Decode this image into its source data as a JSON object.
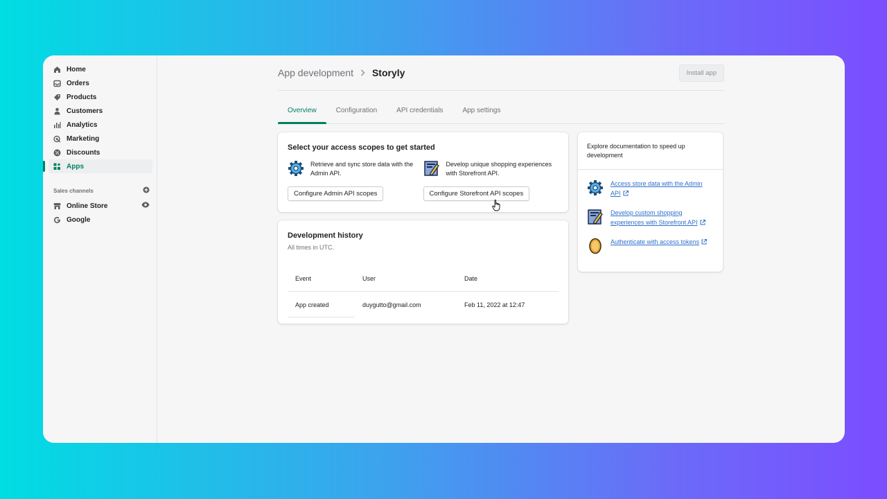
{
  "sidebar": {
    "items": [
      {
        "label": "Home",
        "icon": "home-icon"
      },
      {
        "label": "Orders",
        "icon": "orders-icon"
      },
      {
        "label": "Products",
        "icon": "tag-icon"
      },
      {
        "label": "Customers",
        "icon": "person-icon"
      },
      {
        "label": "Analytics",
        "icon": "bar-chart-icon"
      },
      {
        "label": "Marketing",
        "icon": "target-icon"
      },
      {
        "label": "Discounts",
        "icon": "discount-icon"
      },
      {
        "label": "Apps",
        "icon": "apps-icon",
        "active": true
      }
    ],
    "sales_channels_label": "Sales channels",
    "channels": [
      {
        "label": "Online Store",
        "icon": "store-icon"
      },
      {
        "label": "Google",
        "icon": "google-icon"
      }
    ]
  },
  "header": {
    "breadcrumb_parent": "App development",
    "breadcrumb_separator": ">",
    "page_title": "Storyly",
    "install_button": "Install app"
  },
  "tabs": [
    {
      "label": "Overview",
      "active": true
    },
    {
      "label": "Configuration"
    },
    {
      "label": "API credentials"
    },
    {
      "label": "App settings"
    }
  ],
  "scopes_card": {
    "title": "Select your access scopes to get started",
    "admin": {
      "description": "Retrieve and sync store data with the Admin API.",
      "button": "Configure Admin API scopes"
    },
    "storefront": {
      "description": "Develop unique shopping experiences with Storefront API.",
      "button": "Configure Storefront API scopes"
    }
  },
  "history_card": {
    "title": "Development history",
    "subtitle": "All times in UTC.",
    "columns": [
      "Event",
      "User",
      "Date"
    ],
    "rows": [
      [
        "App created",
        "duygutto@gmail.com",
        "Feb 11, 2022 at 12:47"
      ]
    ]
  },
  "docs_card": {
    "title": "Explore documentation to speed up development",
    "links": [
      {
        "label": "Access store data with the Admin API",
        "icon": "gear-icon"
      },
      {
        "label": "Develop custom shopping experiences with Storefront API",
        "icon": "document-icon"
      },
      {
        "label": "Authenticate with access tokens",
        "icon": "token-icon"
      }
    ]
  },
  "colors": {
    "accent": "#008060",
    "link": "#2c6ecb",
    "text": "#202223",
    "muted": "#6d7175"
  }
}
